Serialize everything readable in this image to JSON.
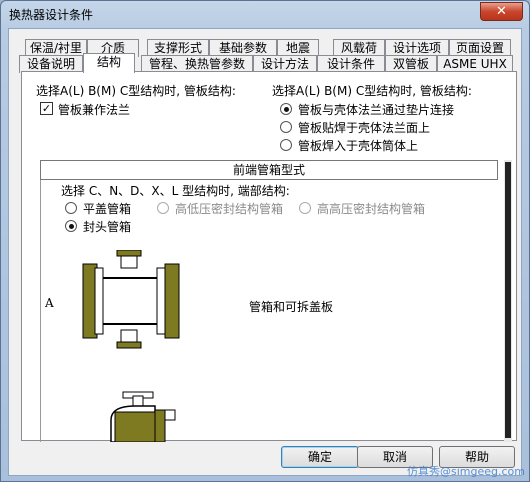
{
  "window": {
    "title": "换热器设计条件",
    "close_glyph": "✕"
  },
  "tabs_row1": [
    "保温/衬里",
    "介质",
    "支撑形式",
    "基础参数",
    "地震",
    "风载荷",
    "设计选项",
    "页面设置"
  ],
  "tabs_row2": [
    "设备说明",
    "结构",
    "管程、换热管参数",
    "设计方法",
    "设计条件",
    "双管板",
    "ASME UHX"
  ],
  "active_tab": "结构",
  "left_section": {
    "label": "选择A(L) B(M) C型结构时, 管板结构:",
    "checkbox_label": "管板兼作法兰",
    "checkbox_checked": true,
    "check_glyph": "✓"
  },
  "right_section": {
    "label": "选择A(L) B(M) C型结构时, 管板结构:",
    "options": [
      "管板与壳体法兰通过垫片连接",
      "管板贴焊于壳体法兰面上",
      "管板焊入于壳体筒体上"
    ],
    "selected_index": 0
  },
  "front_box": {
    "title": "前端管箱型式",
    "label": "选择 C、N、D、X、L 型结构时, 端部结构:",
    "options": [
      "平盖管箱",
      "高低压密封结构管箱",
      "高高压密封结构管箱",
      "封头管箱"
    ],
    "selected": "封头管箱",
    "item_letter": "A",
    "item_desc": "管箱和可拆盖板"
  },
  "buttons": {
    "ok": "确定",
    "cancel": "取消",
    "help": "帮助"
  },
  "watermark": "仿真秀@simgeeg.com"
}
